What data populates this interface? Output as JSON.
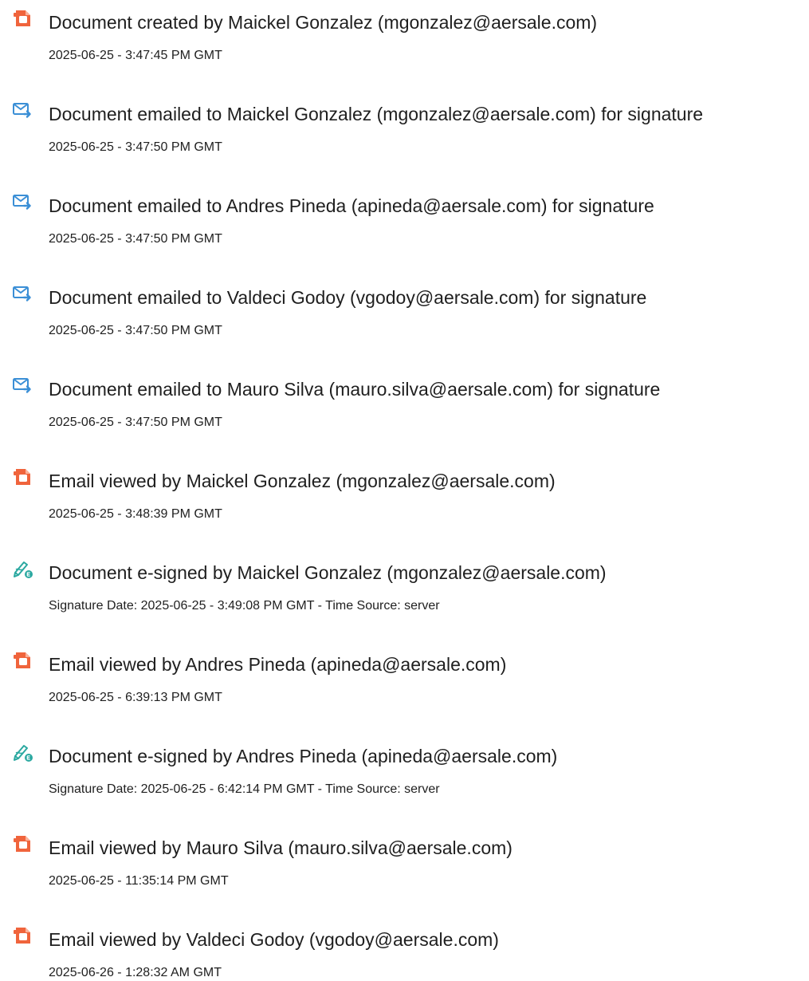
{
  "events": [
    {
      "icon": "document-created-icon",
      "title": "Document created by Maickel Gonzalez (mgonzalez@aersale.com)",
      "detail": "2025-06-25 - 3:47:45 PM GMT"
    },
    {
      "icon": "email-sent-icon",
      "title": "Document emailed to Maickel Gonzalez (mgonzalez@aersale.com) for signature",
      "detail": "2025-06-25 - 3:47:50 PM GMT"
    },
    {
      "icon": "email-sent-icon",
      "title": "Document emailed to Andres Pineda (apineda@aersale.com) for signature",
      "detail": "2025-06-25 - 3:47:50 PM GMT"
    },
    {
      "icon": "email-sent-icon",
      "title": "Document emailed to Valdeci Godoy (vgodoy@aersale.com) for signature",
      "detail": "2025-06-25 - 3:47:50 PM GMT"
    },
    {
      "icon": "email-sent-icon",
      "title": "Document emailed to Mauro Silva (mauro.silva@aersale.com) for signature",
      "detail": "2025-06-25 - 3:47:50 PM GMT"
    },
    {
      "icon": "document-viewed-icon",
      "title": "Email viewed by Maickel Gonzalez (mgonzalez@aersale.com)",
      "detail": "2025-06-25 - 3:48:39 PM GMT"
    },
    {
      "icon": "e-signature-icon",
      "title": "Document e-signed by Maickel Gonzalez (mgonzalez@aersale.com)",
      "detail": "Signature Date: 2025-06-25 - 3:49:08 PM GMT - Time Source: server"
    },
    {
      "icon": "document-viewed-icon",
      "title": "Email viewed by Andres Pineda (apineda@aersale.com)",
      "detail": "2025-06-25 - 6:39:13 PM GMT"
    },
    {
      "icon": "e-signature-icon",
      "title": "Document e-signed by Andres Pineda (apineda@aersale.com)",
      "detail": "Signature Date: 2025-06-25 - 6:42:14 PM GMT - Time Source: server"
    },
    {
      "icon": "document-viewed-icon",
      "title": "Email viewed by Mauro Silva (mauro.silva@aersale.com)",
      "detail": "2025-06-25 - 11:35:14 PM GMT"
    },
    {
      "icon": "document-viewed-icon",
      "title": "Email viewed by Valdeci Godoy (vgodoy@aersale.com)",
      "detail": "2025-06-26 - 1:28:32 AM GMT"
    }
  ],
  "colors": {
    "document_icon": "#f0643c",
    "email_icon": "#3b8fd6",
    "signature_icon": "#2aa8a0"
  }
}
